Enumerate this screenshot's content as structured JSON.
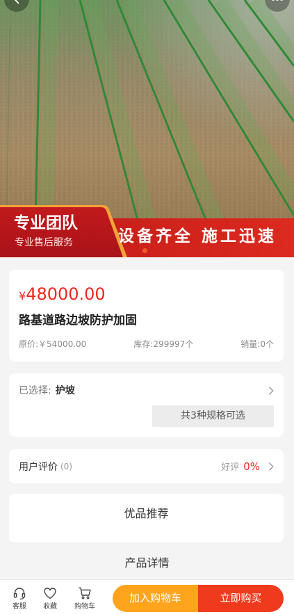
{
  "top_nav": {
    "back_icon": "chevron-left-icon",
    "more_icon": "more-dots-icon"
  },
  "hero": {
    "banner": {
      "left_title": "专业团队",
      "left_subtitle": "专业售后服务",
      "right_slogan": "设备齐全 施工迅速"
    }
  },
  "product": {
    "currency_symbol": "¥",
    "price": "48000.00",
    "title": "路基道路边坡防护加固",
    "original_price": "原价:￥54000.00",
    "stock": "库存:299997个",
    "sales": "销量:0个"
  },
  "spec": {
    "label": "已选择:",
    "selected": "护坡",
    "options_button": "共3种规格可选"
  },
  "reviews": {
    "label": "用户评价",
    "count": "(0)",
    "positive_label": "好评",
    "positive_rate": "0%"
  },
  "recommend": {
    "title": "优品推荐"
  },
  "details": {
    "title": "产品详情"
  },
  "bottom_bar": {
    "actions": [
      {
        "label": "客服",
        "icon": "headset-icon"
      },
      {
        "label": "收藏",
        "icon": "heart-icon"
      },
      {
        "label": "购物车",
        "icon": "cart-icon"
      }
    ],
    "add_to_cart": "加入购物车",
    "buy_now": "立即购买"
  },
  "colors": {
    "price_red": "#f0281c",
    "banner_red": "#d2221b",
    "add_to_cart_orange": "#ffa41c",
    "buy_now_red": "#f03a1e",
    "page_background": "#f4f4f4"
  }
}
